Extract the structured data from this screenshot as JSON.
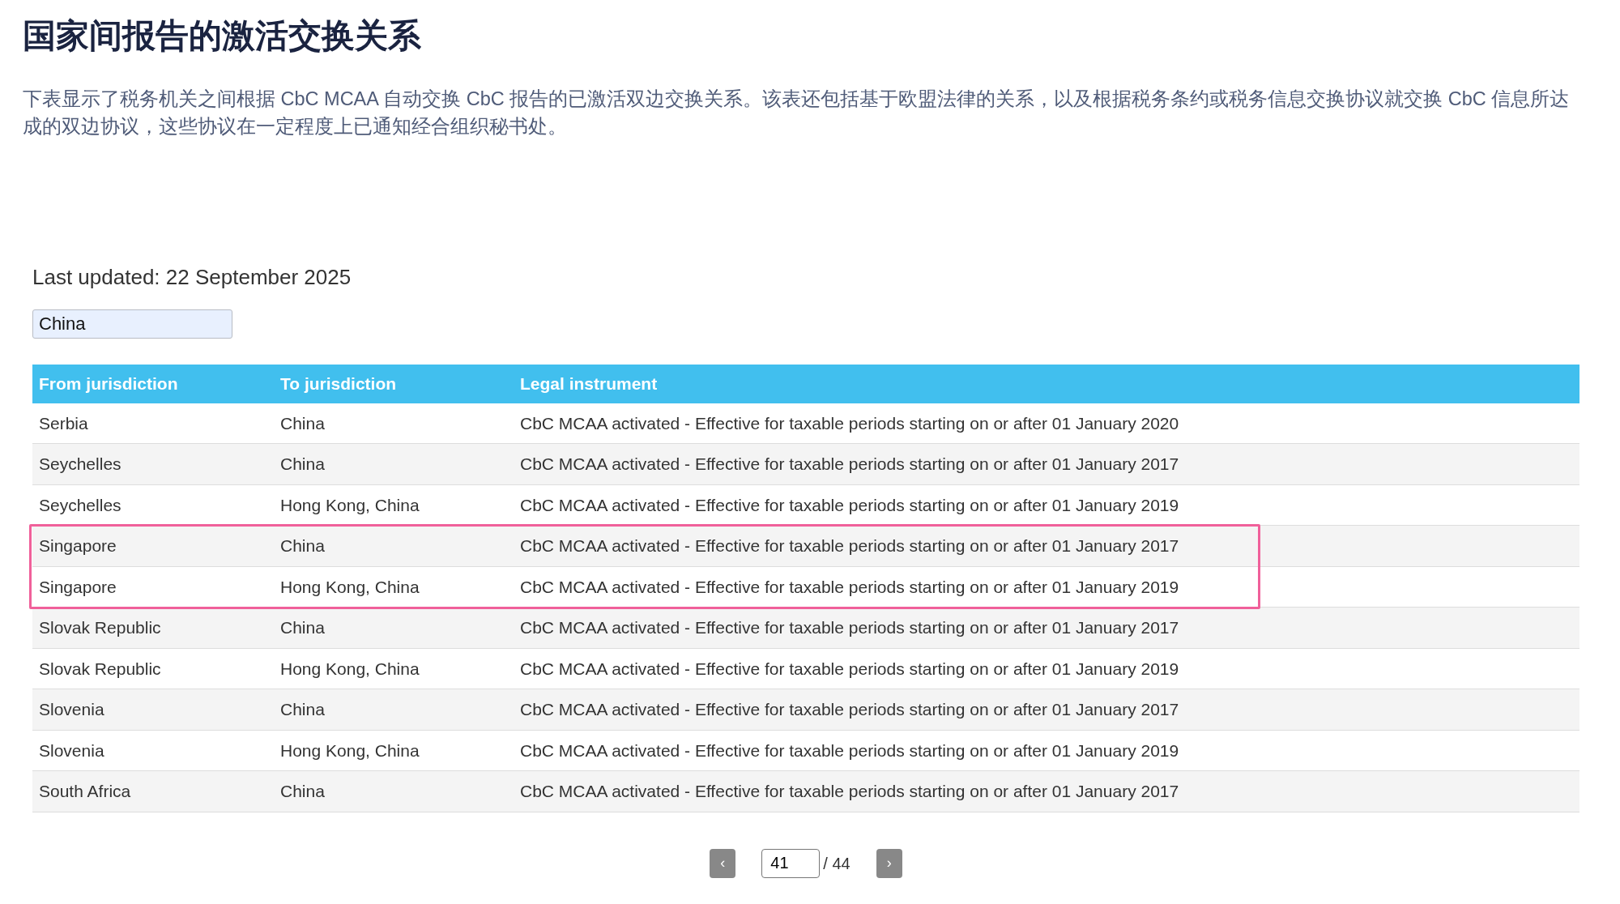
{
  "title": "国家间报告的激活交换关系",
  "description": "下表显示了税务机关之间根据 CbC MCAA 自动交换 CbC 报告的已激活双边交换关系。该表还包括基于欧盟法律的关系，以及根据税务条约或税务信息交换协议就交换 CbC 信息所达成的双边协议，这些协议在一定程度上已通知经合组织秘书处。",
  "last_updated": "Last updated: 22 September 2025",
  "filter": {
    "value": "China"
  },
  "table": {
    "columns": [
      "From jurisdiction",
      "To jurisdiction",
      "Legal instrument"
    ],
    "rows": [
      {
        "cells": [
          "Serbia",
          "China",
          "CbC MCAA activated - Effective for taxable periods starting on or after 01 January 2020"
        ],
        "highlighted": false
      },
      {
        "cells": [
          "Seychelles",
          "China",
          "CbC MCAA activated - Effective for taxable periods starting on or after 01 January 2017"
        ],
        "highlighted": false
      },
      {
        "cells": [
          "Seychelles",
          "Hong Kong, China",
          "CbC MCAA activated - Effective for taxable periods starting on or after 01 January 2019"
        ],
        "highlighted": false
      },
      {
        "cells": [
          "Singapore",
          "China",
          "CbC MCAA activated - Effective for taxable periods starting on or after 01 January 2017"
        ],
        "highlighted": true
      },
      {
        "cells": [
          "Singapore",
          "Hong Kong, China",
          "CbC MCAA activated - Effective for taxable periods starting on or after 01 January 2019"
        ],
        "highlighted": true
      },
      {
        "cells": [
          "Slovak Republic",
          "China",
          "CbC MCAA activated - Effective for taxable periods starting on or after 01 January 2017"
        ],
        "highlighted": false
      },
      {
        "cells": [
          "Slovak Republic",
          "Hong Kong, China",
          "CbC MCAA activated - Effective for taxable periods starting on or after 01 January 2019"
        ],
        "highlighted": false
      },
      {
        "cells": [
          "Slovenia",
          "China",
          "CbC MCAA activated - Effective for taxable periods starting on or after 01 January 2017"
        ],
        "highlighted": false
      },
      {
        "cells": [
          "Slovenia",
          "Hong Kong, China",
          "CbC MCAA activated - Effective for taxable periods starting on or after 01 January 2019"
        ],
        "highlighted": false
      },
      {
        "cells": [
          "South Africa",
          "China",
          "CbC MCAA activated - Effective for taxable periods starting on or after 01 January 2017"
        ],
        "highlighted": false
      }
    ]
  },
  "pagination": {
    "prev": "‹",
    "page": "41",
    "total": "/ 44",
    "next": "›"
  }
}
